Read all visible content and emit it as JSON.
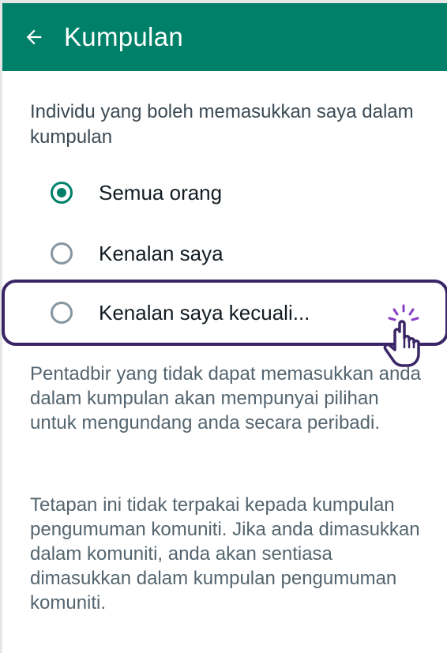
{
  "header": {
    "title": "Kumpulan",
    "back_icon": "arrow-left-icon",
    "background_color": "#008069"
  },
  "section": {
    "heading": "Individu yang boleh memasukkan saya dalam kumpulan"
  },
  "options": [
    {
      "label": "Semua orang",
      "selected": true
    },
    {
      "label": "Kenalan saya",
      "selected": false
    },
    {
      "label": "Kenalan saya kecuali...",
      "selected": false,
      "highlighted": true
    }
  ],
  "descriptions": {
    "admin_note": "Pentadbir yang tidak dapat memasukkan anda dalam kumpulan akan mempunyai pilihan untuk mengundang anda secara peribadi.",
    "community_note": "Tetapan ini tidak terpakai kepada kumpulan pengumuman komuniti. Jika anda dimasukkan dalam komuniti, anda akan sentiasa dimasukkan dalam kumpulan pengumuman komuniti."
  },
  "pointer": {
    "icon": "tap-hand-icon"
  },
  "colors": {
    "accent": "#008069",
    "highlight_border": "#3a2566",
    "pointer_accent": "#8a3fc7"
  }
}
